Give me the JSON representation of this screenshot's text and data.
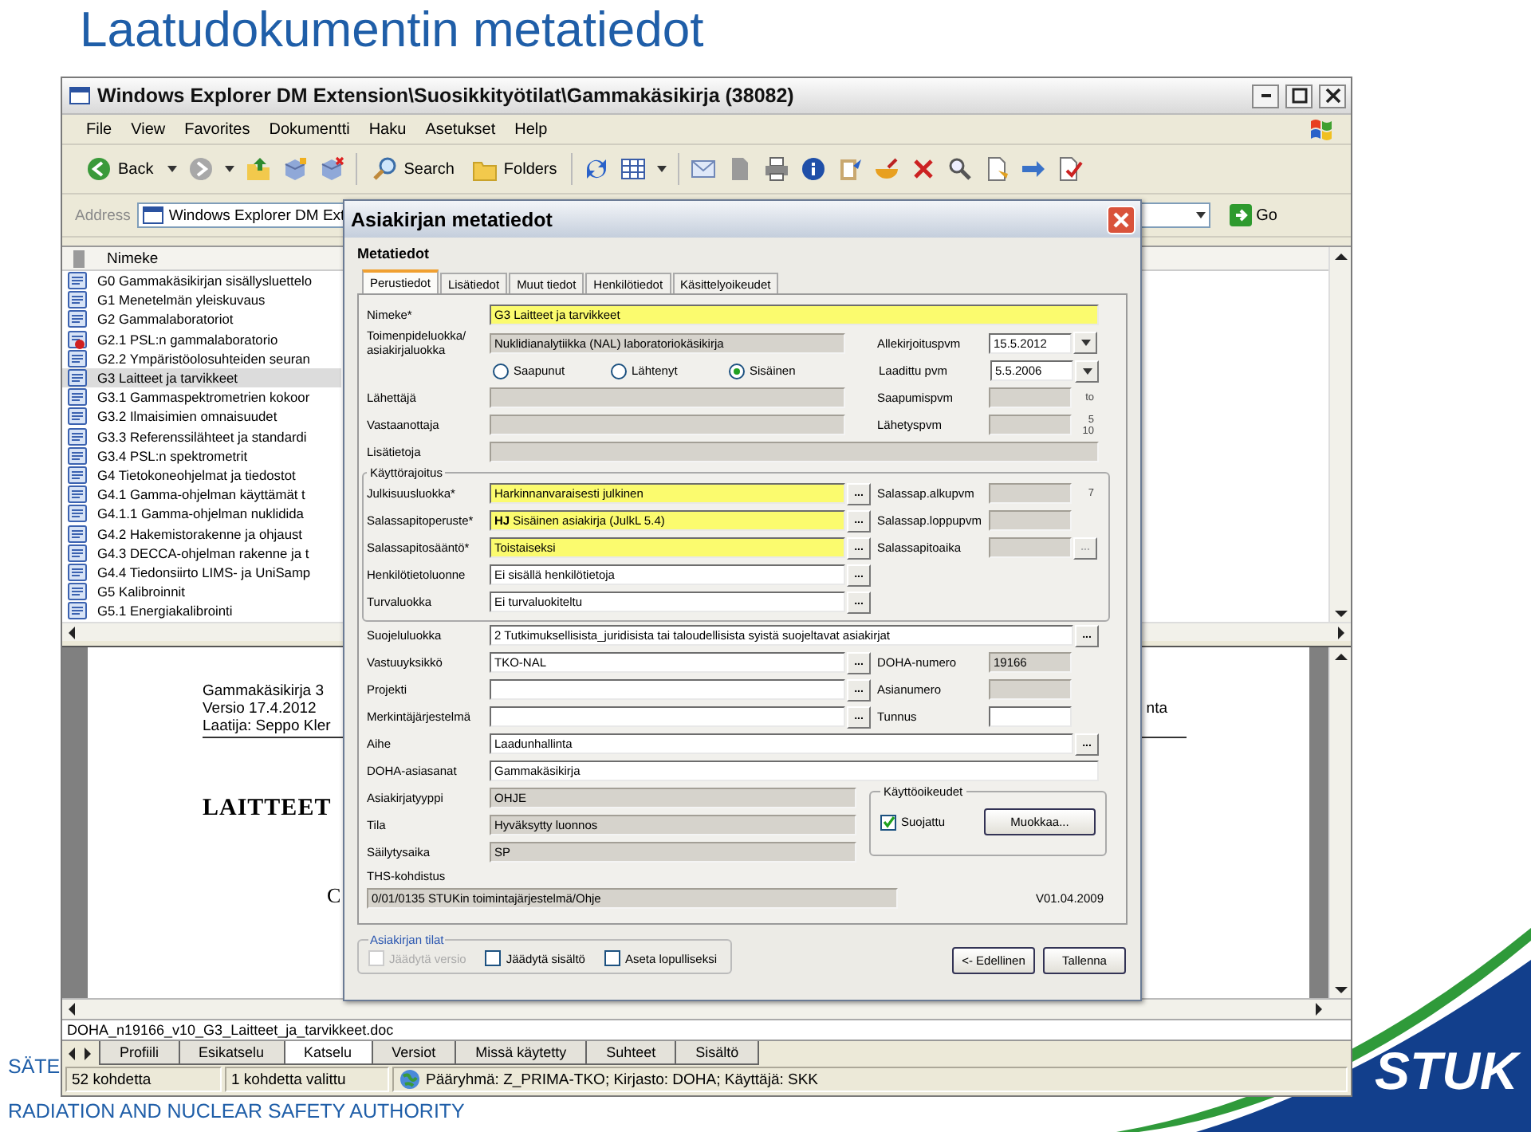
{
  "slide": {
    "title": "Laatudokumentin metatiedot",
    "footer": [
      "SÄTE",
      "RADIATION AND NUCLEAR SAFETY AUTHORITY"
    ],
    "logo": "STUK"
  },
  "explorer": {
    "title": "Windows Explorer DM Extension\\Suosikkityötilat\\Gammakäsikirja (38082)",
    "menu": [
      "File",
      "View",
      "Favorites",
      "Dokumentti",
      "Haku",
      "Asetukset",
      "Help"
    ],
    "toolbar": {
      "back": "Back",
      "search": "Search",
      "folders": "Folders"
    },
    "address": {
      "label": "Address",
      "value": "Windows Explorer DM Ext",
      "go": "Go"
    },
    "list": {
      "column": "Nimeke",
      "items": [
        {
          "name": "G0 Gammakäsikirjan sisällysluettelo",
          "selected": false,
          "locked": false
        },
        {
          "name": "G1 Menetelmän yleiskuvaus",
          "selected": false,
          "locked": false
        },
        {
          "name": "G2 Gammalaboratoriot",
          "selected": false,
          "locked": false
        },
        {
          "name": "G2.1 PSL:n gammalaboratorio",
          "selected": false,
          "locked": true
        },
        {
          "name": "G2.2 Ympäristöolosuhteiden seuran",
          "selected": false,
          "locked": false
        },
        {
          "name": "G3 Laitteet ja tarvikkeet",
          "selected": true,
          "locked": false
        },
        {
          "name": "G3.1 Gammaspektrometrien kokoor",
          "selected": false,
          "locked": false
        },
        {
          "name": "G3.2 Ilmaisimien omnaisuudet",
          "selected": false,
          "locked": false
        },
        {
          "name": "G3.3 Referenssilähteet ja standardi",
          "selected": false,
          "locked": false
        },
        {
          "name": "G3.4 PSL:n spektrometrit",
          "selected": false,
          "locked": false
        },
        {
          "name": "G4 Tietokoneohjelmat ja tiedostot",
          "selected": false,
          "locked": false
        },
        {
          "name": "G4.1 Gamma-ohjelman käyttämät t",
          "selected": false,
          "locked": false
        },
        {
          "name": "G4.1.1 Gamma-ohjelman nuklidida",
          "selected": false,
          "locked": false
        },
        {
          "name": "G4.2 Hakemistorakenne ja ohjaust",
          "selected": false,
          "locked": false
        },
        {
          "name": "G4.3 DECCA-ohjelman rakenne ja t",
          "selected": false,
          "locked": false
        },
        {
          "name": "G4.4 Tiedonsiirto LIMS- ja UniSamp",
          "selected": false,
          "locked": false
        },
        {
          "name": "G5 Kalibroinnit",
          "selected": false,
          "locked": false
        },
        {
          "name": "G5.1 Energiakalibrointi",
          "selected": false,
          "locked": false
        }
      ]
    },
    "preview": {
      "header_lines": [
        "Gammakäsikirja 3",
        "Versio  17.4.2012",
        "Laatija: Seppo Kler"
      ],
      "header_right": "nta",
      "heading": "LAITTEET",
      "fragment": "C"
    },
    "file_name": "DOHA_n19166_v10_G3_Laitteet_ja_tarvikkeet.doc",
    "tabs": [
      {
        "label": "Profiili",
        "selected": false
      },
      {
        "label": "Esikatselu",
        "selected": false
      },
      {
        "label": "Katselu",
        "selected": true
      },
      {
        "label": "Versiot",
        "selected": false
      },
      {
        "label": "Missä käytetty",
        "selected": false
      },
      {
        "label": "Suhteet",
        "selected": false
      },
      {
        "label": "Sisältö",
        "selected": false
      }
    ],
    "status_bar": [
      "52 kohdetta",
      "1 kohdetta valittu",
      "Pääryhmä: Z_PRIMA-TKO; Kirjasto: DOHA; Käyttäjä: SKK"
    ]
  },
  "dialog": {
    "title": "Asiakirjan metatiedot",
    "heading": "Metatiedot",
    "tabs": [
      {
        "label": "Perustiedot",
        "selected": true
      },
      {
        "label": "Lisätiedot",
        "selected": false
      },
      {
        "label": "Muut tiedot",
        "selected": false
      },
      {
        "label": "Henkilötiedot",
        "selected": false
      },
      {
        "label": "Käsittelyoikeudet",
        "selected": false
      }
    ],
    "rows": [
      {
        "kind": "wide",
        "label": "Nimeke*",
        "value": "G3 Laitteet ja tarvikkeet",
        "required": true,
        "readonly": false
      },
      {
        "kind": "field",
        "label": "Toimenpideluokka/ asiakirjaluokka",
        "value": "Nuklidianalytiikka (NAL) laboratoriokäsikirja",
        "required": false,
        "readonly": true,
        "side": {
          "label": "Allekirjoituspvm",
          "value": "15.5.2012",
          "required": false,
          "readonly": false,
          "dropdown": true
        }
      },
      {
        "kind": "radios",
        "options": [
          {
            "label": "Saapunut",
            "selected": false
          },
          {
            "label": "Lähtenyt",
            "selected": false
          },
          {
            "label": "Sisäinen",
            "selected": true
          }
        ],
        "side": {
          "label": "Laadittu pvm",
          "value": "5.5.2006",
          "required": false,
          "readonly": false,
          "dropdown": true
        }
      },
      {
        "kind": "field",
        "label": "Lähettäjä",
        "required": false,
        "readonly": true,
        "side": {
          "label": "Saapumispvm",
          "required": false,
          "readonly": true,
          "peek": [
            "to"
          ]
        }
      },
      {
        "kind": "field",
        "label": "Vastaanottaja",
        "required": false,
        "readonly": true,
        "side": {
          "label": "Lähetyspvm",
          "required": false,
          "readonly": true,
          "peek": [
            "5",
            "10"
          ]
        }
      },
      {
        "kind": "wide",
        "label": "Lisätietoja",
        "required": false,
        "readonly": true
      },
      {
        "kind": "group",
        "legend": "Käyttörajoitus",
        "rows": [
          {
            "kind": "field",
            "label": "Julkisuusluokka*",
            "value": "Harkinnanvaraisesti julkinen",
            "required": true,
            "readonly": false,
            "browse": {
              "text": "...",
              "disabled": false
            },
            "side": {
              "label": "Salassap.alkupvm",
              "required": false,
              "readonly": true,
              "peek": [
                "7"
              ]
            }
          },
          {
            "kind": "field",
            "label": "Salassapitoperuste*",
            "value": "**HJ** Sisäinen asiakirja (JulkL 5.4)",
            "required": true,
            "readonly": false,
            "browse": {
              "text": "...",
              "disabled": false
            },
            "side": {
              "label": "Salassap.loppupvm",
              "required": false,
              "readonly": true
            }
          },
          {
            "kind": "field",
            "label": "Salassapitosääntö*",
            "value": "Toistaiseksi",
            "required": true,
            "readonly": false,
            "browse": {
              "text": "...",
              "disabled": false
            },
            "side": {
              "label": "Salassapitoaika",
              "required": false,
              "readonly": true,
              "browse": {
                "text": "...",
                "disabled": true
              }
            }
          },
          {
            "kind": "field",
            "label": "Henkilötietoluonne",
            "value": "Ei sisällä henkilötietoja",
            "required": false,
            "readonly": false,
            "browse": {
              "text": "...",
              "disabled": false
            }
          },
          {
            "kind": "field",
            "label": "Turvaluokka",
            "value": "Ei turvaluokiteltu",
            "required": false,
            "readonly": false,
            "browse": {
              "text": "...",
              "disabled": false
            }
          }
        ]
      },
      {
        "kind": "wide",
        "label": "Suojeluluokka",
        "value": "2 Tutkimuksellisista_juridisista tai taloudellisista syistä suojeltavat asiakirjat",
        "required": false,
        "readonly": false,
        "browse": {
          "text": "...",
          "disabled": false
        }
      },
      {
        "kind": "field",
        "label": "Vastuuyksikkö",
        "value": "TKO-NAL",
        "required": false,
        "readonly": false,
        "browse": {
          "text": "...",
          "disabled": false
        },
        "side": {
          "label": "DOHA-numero",
          "value": "19166",
          "required": false,
          "readonly": true
        }
      },
      {
        "kind": "field",
        "label": "Projekti",
        "required": false,
        "readonly": false,
        "browse": {
          "text": "...",
          "disabled": false
        },
        "side": {
          "label": "Asianumero",
          "required": false,
          "readonly": true
        }
      },
      {
        "kind": "field",
        "label": "Merkintäjärjestelmä",
        "required": false,
        "readonly": false,
        "browse": {
          "text": "...",
          "disabled": false
        },
        "side": {
          "label": "Tunnus",
          "required": false,
          "readonly": false
        }
      },
      {
        "kind": "wide",
        "label": "Aihe",
        "value": "Laadunhallinta",
        "required": false,
        "readonly": false,
        "browse": {
          "text": "...",
          "disabled": false
        }
      },
      {
        "kind": "wide",
        "label": "DOHA-asiasanat",
        "value": "Gammakäsikirja",
        "required": false,
        "readonly": false
      },
      {
        "kind": "block",
        "rows": [
          {
            "kind": "field",
            "label": "Asiakirjatyyppi",
            "value": "OHJE",
            "required": false,
            "readonly": true
          },
          {
            "kind": "field",
            "label": "Tila",
            "value": "Hyväksytty luonnos",
            "required": false,
            "readonly": true
          },
          {
            "kind": "field",
            "label": "Säilytysaika",
            "value": "SP",
            "required": false,
            "readonly": true
          }
        ],
        "panel": {
          "legend": "Käyttöoikeudet",
          "checkbox": {
            "label": "Suojattu",
            "checked": true
          },
          "button": "Muokkaa..."
        }
      },
      {
        "kind": "assignment",
        "label": "THS-kohdistus",
        "value": "0/01/0135 STUKin toimintajärjestelmä/Ohje",
        "required": false,
        "readonly": true,
        "version": "V01.04.2009"
      }
    ],
    "states": {
      "legend": "Asiakirjan tilat",
      "options": [
        {
          "label": "Jäädytä versio",
          "checked": false,
          "disabled": true
        },
        {
          "label": "Jäädytä sisältö",
          "checked": false,
          "disabled": false
        },
        {
          "label": "Aseta lopulliseksi",
          "checked": false,
          "disabled": false
        }
      ]
    },
    "buttons": [
      "<- Edellinen",
      "Tallenna"
    ]
  }
}
